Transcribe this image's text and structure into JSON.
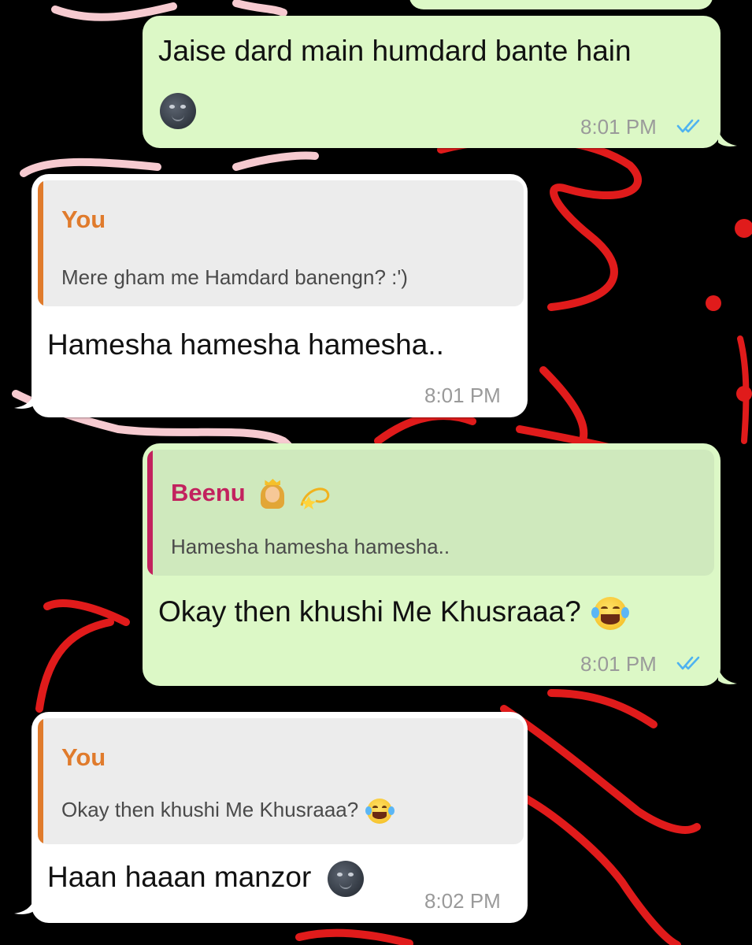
{
  "colors": {
    "outgoing_bubble": "#dcf8c6",
    "incoming_bubble": "#ffffff",
    "quote_you": "#e07b2c",
    "quote_beenu": "#c2225e",
    "read_ticks": "#4fb3f0",
    "timestamp": "#9a9a9a",
    "wallpaper": "#000000",
    "scribble_red": "#e01b1b",
    "scribble_pink": "#f6cad0"
  },
  "messages": [
    {
      "direction": "outgoing",
      "text": "Jaise dard main humdard bante hain",
      "emoji": "new-moon-face",
      "time": "8:01 PM",
      "status": "read"
    },
    {
      "direction": "incoming",
      "quote": {
        "author": "You",
        "text": "Mere gham me Hamdard banengn? :')"
      },
      "text": "Hamesha hamesha hamesha..",
      "time": "8:01 PM"
    },
    {
      "direction": "outgoing",
      "quote": {
        "author": "Beenu",
        "author_emojis": [
          "princess",
          "dizzy"
        ],
        "text": "Hamesha hamesha hamesha.."
      },
      "text": "Okay then khushi Me Khusraaa?",
      "emoji": "face-with-tears-of-joy",
      "time": "8:01 PM",
      "status": "read"
    },
    {
      "direction": "incoming",
      "quote": {
        "author": "You",
        "text": "Okay then khushi Me Khusraaa?",
        "emoji": "face-with-tears-of-joy"
      },
      "text": "Haan haaan manzor",
      "emoji": "new-moon-face",
      "time": "8:02 PM"
    }
  ]
}
